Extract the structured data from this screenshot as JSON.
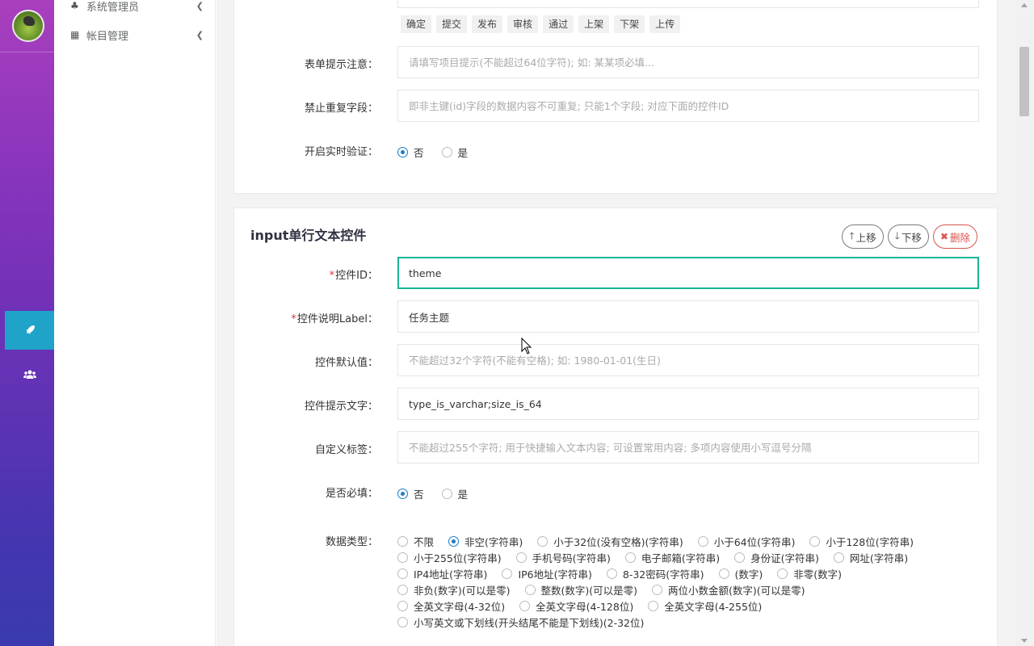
{
  "sidebar": {
    "items": [
      {
        "label": "系统管理员"
      },
      {
        "label": "帐目管理"
      }
    ]
  },
  "panel1": {
    "tags": [
      "确定",
      "提交",
      "发布",
      "审核",
      "通过",
      "上架",
      "下架",
      "上传"
    ],
    "form_tip": {
      "label": "表单提示注意：",
      "placeholder": "请填写项目提示(不能超过64位字符); 如: 某某项必填..."
    },
    "no_dup": {
      "label": "禁止重复字段：",
      "placeholder": "即非主键(id)字段的数据内容不可重复; 只能1个字段; 对应下面的控件ID"
    },
    "realtime": {
      "label": "开启实时验证：",
      "opt_no": "否",
      "opt_yes": "是"
    }
  },
  "panel2": {
    "title": "input单行文本控件",
    "move_up": "上移",
    "move_down": "下移",
    "delete": "删除",
    "control_id": {
      "label": "控件ID：",
      "value": "theme"
    },
    "control_label": {
      "label": "控件说明Label：",
      "value": "任务主题"
    },
    "default_value": {
      "label": "控件默认值：",
      "placeholder": "不能超过32个字符(不能有空格); 如: 1980-01-01(生日)"
    },
    "hint_text": {
      "label": "控件提示文字：",
      "value": "type_is_varchar;size_is_64"
    },
    "custom_tags": {
      "label": "自定义标签：",
      "placeholder": "不能超过255个字符; 用于快捷输入文本内容; 可设置常用内容; 多项内容使用小写逗号分隔"
    },
    "required": {
      "label": "是否必填：",
      "opt_no": "否",
      "opt_yes": "是"
    },
    "data_type": {
      "label": "数据类型：",
      "lines": [
        [
          "不限",
          "非空(字符串)",
          "小于32位(没有空格)(字符串)",
          "小于64位(字符串)",
          "小于128位(字符串)"
        ],
        [
          "小于255位(字符串)",
          "手机号码(字符串)",
          "电子邮箱(字符串)",
          "身份证(字符串)",
          "网址(字符串)"
        ],
        [
          "IP4地址(字符串)",
          "IP6地址(字符串)",
          "8-32密码(字符串)",
          "(数字)",
          "非零(数字)"
        ],
        [
          "非负(数字)(可以是零)",
          "整数(数字)(可以是零)",
          "两位小数金额(数字)(可以是零)"
        ],
        [
          "全英文字母(4-32位)",
          "全英文字母(4-128位)",
          "全英文字母(4-255位)"
        ],
        [
          "小写英文或下划线(开头结尾不能是下划线)(2-32位)"
        ]
      ],
      "selected": "非空(字符串)"
    }
  },
  "colors": {
    "accent": "#1ab394",
    "radio": "#1a7dc5",
    "danger": "#d9534f",
    "rail_active": "#1fa3c9"
  }
}
